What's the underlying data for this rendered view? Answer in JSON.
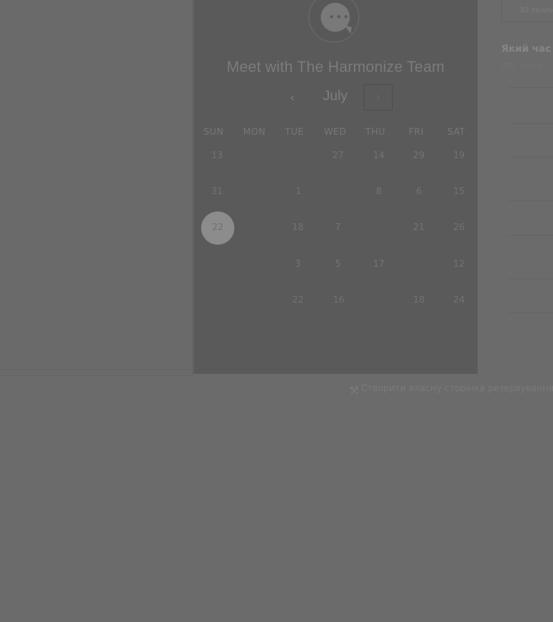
{
  "header": {
    "title": "Meet with The Harmonize Team"
  },
  "calendar": {
    "month": "July",
    "prev_label": "‹",
    "next_label": "›",
    "weekdays": [
      "SUN",
      "MON",
      "TUE",
      "WED",
      "THU",
      "FRI",
      "SAT"
    ],
    "selected_day": "22",
    "days": [
      "13",
      "27",
      "14",
      "29",
      "19",
      "31",
      "1",
      "8",
      "6",
      "15",
      "22",
      "18",
      "7",
      "21",
      "26",
      "3",
      "5",
      "17",
      "12",
      "22",
      "16",
      "18",
      "24"
    ]
  },
  "right_panel": {
    "duration_button": "30 хвили",
    "question": "Який час",
    "timezone": "UTC +00:0"
  },
  "footer": {
    "create_link": "Створити власну сторінка резервування"
  }
}
